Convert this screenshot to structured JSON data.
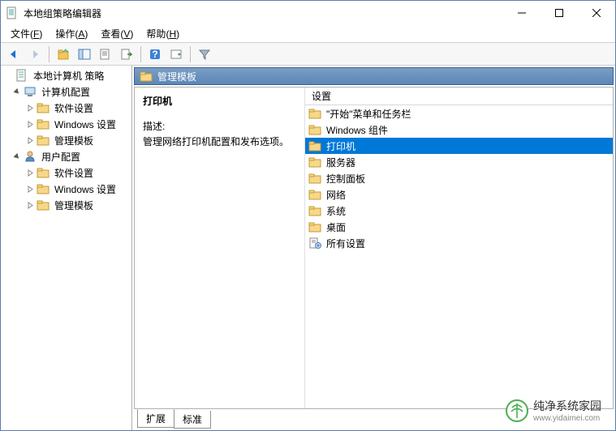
{
  "window": {
    "title": "本地组策略编辑器"
  },
  "menubar": [
    {
      "label": "文件",
      "accel": "F"
    },
    {
      "label": "操作",
      "accel": "A"
    },
    {
      "label": "查看",
      "accel": "V"
    },
    {
      "label": "帮助",
      "accel": "H"
    }
  ],
  "tree": {
    "root": "本地计算机 策略",
    "nodes": [
      {
        "label": "计算机配置",
        "expanded": true,
        "children": [
          {
            "label": "软件设置"
          },
          {
            "label": "Windows 设置"
          },
          {
            "label": "管理模板",
            "selected": false
          }
        ]
      },
      {
        "label": "用户配置",
        "expanded": true,
        "children": [
          {
            "label": "软件设置"
          },
          {
            "label": "Windows 设置"
          },
          {
            "label": "管理模板"
          }
        ]
      }
    ]
  },
  "right": {
    "header": "管理模板",
    "detail": {
      "name": "打印机",
      "desc_label": "描述:",
      "desc_text": "管理网络打印机配置和发布选项。"
    },
    "list": {
      "column_header": "设置",
      "items": [
        {
          "label": "\"开始\"菜单和任务栏",
          "type": "folder",
          "selected": false
        },
        {
          "label": "Windows 组件",
          "type": "folder",
          "selected": false
        },
        {
          "label": "打印机",
          "type": "folder",
          "selected": true
        },
        {
          "label": "服务器",
          "type": "folder",
          "selected": false
        },
        {
          "label": "控制面板",
          "type": "folder",
          "selected": false
        },
        {
          "label": "网络",
          "type": "folder",
          "selected": false
        },
        {
          "label": "系统",
          "type": "folder",
          "selected": false
        },
        {
          "label": "桌面",
          "type": "folder",
          "selected": false
        },
        {
          "label": "所有设置",
          "type": "settings",
          "selected": false
        }
      ]
    }
  },
  "tabs": [
    {
      "label": "扩展",
      "active": true
    },
    {
      "label": "标准",
      "active": false
    }
  ],
  "watermark": {
    "brand": "纯净系统家园",
    "url": "www.yidaimei.com"
  }
}
